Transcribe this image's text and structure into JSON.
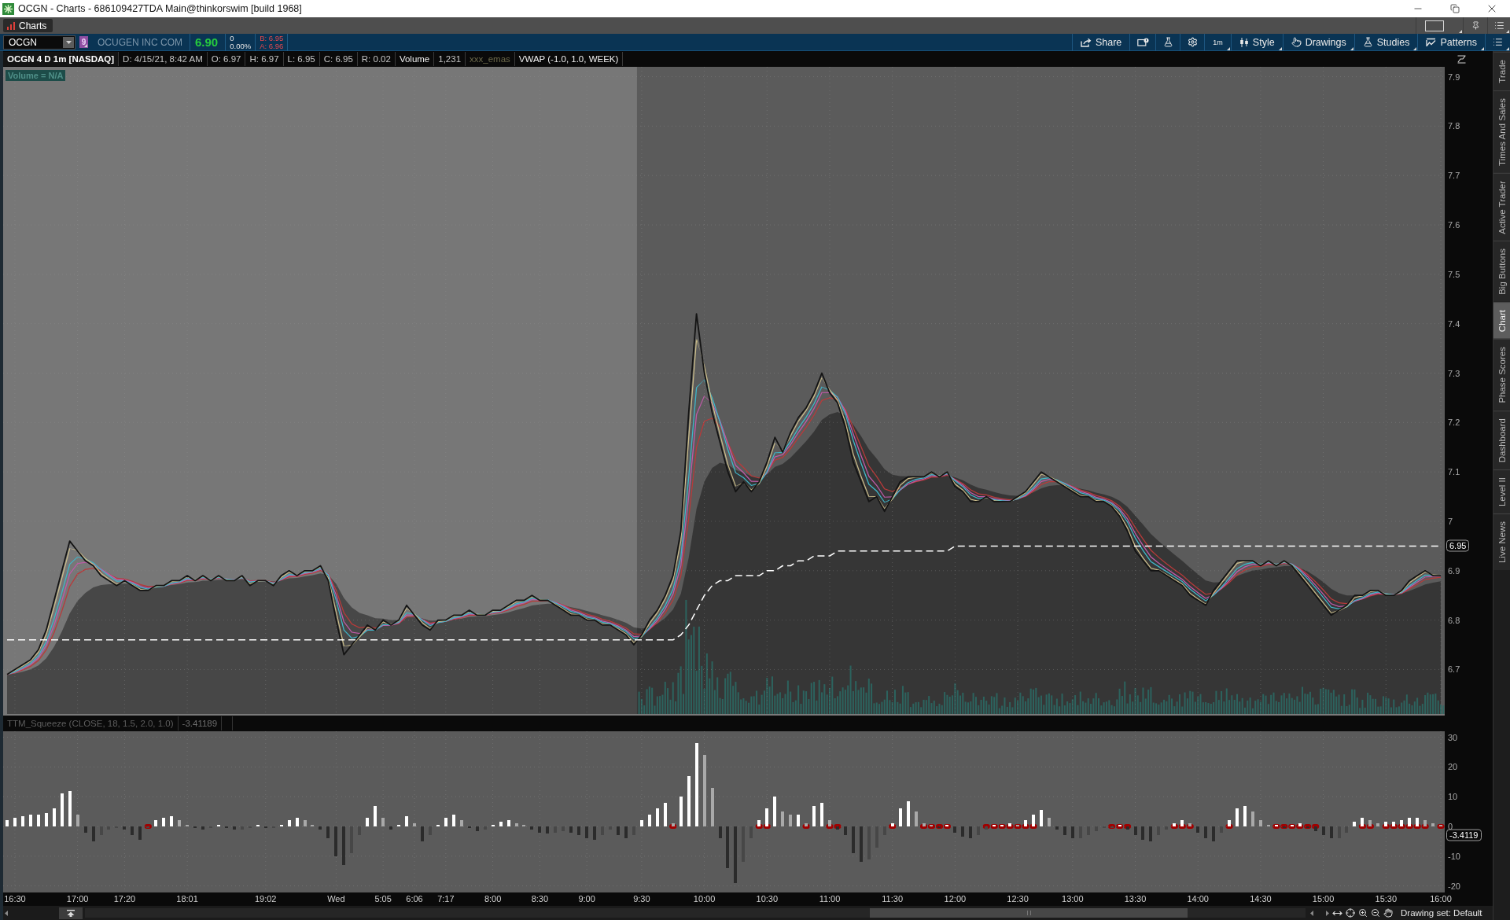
{
  "window": {
    "title": "OCGN - Charts - 686109427TDA Main@thinkorswim [build 1968]"
  },
  "tabs": [
    {
      "label": "Charts",
      "selected": true
    }
  ],
  "quote_bar": {
    "symbol": "OCGN",
    "link_group": "9",
    "description": "OCUGEN INC COM",
    "last": "6.90",
    "net_change": "0",
    "percent_change": "0.00%",
    "bid": "B: 6.95",
    "ask": "A: 6.96"
  },
  "toolbar": {
    "buttons": [
      {
        "label": "Share",
        "kind": "action"
      },
      {
        "label": "1m",
        "kind": "menu"
      },
      {
        "label": "Style",
        "kind": "menu"
      },
      {
        "label": "Drawings",
        "kind": "menu"
      },
      {
        "label": "Studies",
        "kind": "menu"
      },
      {
        "label": "Patterns",
        "kind": "menu"
      }
    ]
  },
  "legend": [
    {
      "text": "OCGN 4 D 1m [NASDAQ]",
      "kind": "symbol"
    },
    {
      "text": "D: 4/15/21, 8:42 AM",
      "kind": "field"
    },
    {
      "text": "O: 6.97",
      "kind": "field"
    },
    {
      "text": "H: 6.97",
      "kind": "field"
    },
    {
      "text": "L: 6.95",
      "kind": "field"
    },
    {
      "text": "C: 6.95",
      "kind": "field"
    },
    {
      "text": "R: 0.02",
      "kind": "field"
    },
    {
      "text": "Volume",
      "kind": "study"
    },
    {
      "text": "1,231",
      "kind": "field"
    },
    {
      "text": "xxx_emas",
      "kind": "muted"
    },
    {
      "text": "VWAP (-1.0, 1.0, WEEK)",
      "kind": "study"
    }
  ],
  "price_chart": {
    "volume_label": "Volume = N/A",
    "price_badge": "6.95",
    "chart_data": {
      "type": "line",
      "grid": true,
      "ylim": [
        6.61,
        7.92
      ],
      "yticks": [
        7.9,
        7.8,
        7.7,
        7.6,
        7.5,
        7.4,
        7.3,
        7.2,
        7.1,
        7,
        6.9,
        6.8,
        6.7
      ],
      "series": [
        {
          "color": "#141414",
          "values": [
            6.69,
            6.7,
            6.71,
            6.72,
            6.74,
            6.78,
            6.84,
            6.9,
            6.96,
            6.94,
            6.92,
            6.91,
            6.89,
            6.88,
            6.87,
            6.88,
            6.87,
            6.86,
            6.86,
            6.87,
            6.87,
            6.88,
            6.88,
            6.89,
            6.88,
            6.89,
            6.88,
            6.89,
            6.88,
            6.88,
            6.89,
            6.87,
            6.88,
            6.88,
            6.87,
            6.89,
            6.9,
            6.89,
            6.9,
            6.9,
            6.91,
            6.88,
            6.8,
            6.73,
            6.75,
            6.77,
            6.79,
            6.78,
            6.8,
            6.79,
            6.8,
            6.83,
            6.81,
            6.79,
            6.78,
            6.8,
            6.8,
            6.81,
            6.81,
            6.82,
            6.81,
            6.81,
            6.82,
            6.82,
            6.83,
            6.84,
            6.84,
            6.85,
            6.84,
            6.84,
            6.83,
            6.82,
            6.81,
            6.81,
            6.8,
            6.8,
            6.79,
            6.79,
            6.78,
            6.77,
            6.75,
            6.77,
            6.8,
            6.82,
            6.85,
            6.89,
            6.98,
            7.22,
            7.42,
            7.3,
            7.22,
            7.16,
            7.1,
            7.06,
            7.08,
            7.06,
            7.08,
            7.12,
            7.17,
            7.14,
            7.18,
            7.21,
            7.23,
            7.26,
            7.3,
            7.26,
            7.24,
            7.19,
            7.12,
            7.08,
            7.04,
            7.05,
            7.02,
            7.05,
            7.08,
            7.09,
            7.09,
            7.09,
            7.1,
            7.09,
            7.1,
            7.07,
            7.06,
            7.04,
            7.04,
            7.05,
            7.04,
            7.04,
            7.04,
            7.05,
            7.06,
            7.08,
            7.1,
            7.09,
            7.08,
            7.07,
            7.06,
            7.05,
            7.05,
            7.04,
            7.04,
            7.03,
            7.01,
            6.98,
            6.94,
            6.92,
            6.9,
            6.9,
            6.89,
            6.88,
            6.87,
            6.85,
            6.84,
            6.83,
            6.86,
            6.88,
            6.9,
            6.92,
            6.92,
            6.92,
            6.91,
            6.92,
            6.91,
            6.92,
            6.91,
            6.89,
            6.87,
            6.85,
            6.83,
            6.81,
            6.82,
            6.83,
            6.85,
            6.85,
            6.86,
            6.86,
            6.85,
            6.85,
            6.86,
            6.88,
            6.89,
            6.9,
            6.89,
            6.89
          ]
        },
        {
          "color": "#ffffff",
          "line_style": "dashed",
          "values": [
            6.76,
            6.76,
            6.76,
            6.76,
            6.76,
            6.76,
            6.76,
            6.76,
            6.76,
            6.76,
            6.76,
            6.76,
            6.76,
            6.76,
            6.76,
            6.76,
            6.76,
            6.76,
            6.76,
            6.76,
            6.76,
            6.76,
            6.76,
            6.76,
            6.76,
            6.76,
            6.76,
            6.76,
            6.76,
            6.76,
            6.76,
            6.76,
            6.76,
            6.76,
            6.76,
            6.76,
            6.76,
            6.76,
            6.76,
            6.76,
            6.76,
            6.76,
            6.76,
            6.76,
            6.76,
            6.76,
            6.76,
            6.76,
            6.76,
            6.76,
            6.76,
            6.76,
            6.76,
            6.76,
            6.76,
            6.76,
            6.76,
            6.76,
            6.76,
            6.76,
            6.76,
            6.76,
            6.76,
            6.76,
            6.76,
            6.76,
            6.76,
            6.76,
            6.76,
            6.76,
            6.76,
            6.76,
            6.76,
            6.76,
            6.76,
            6.76,
            6.76,
            6.76,
            6.76,
            6.76,
            6.76,
            6.76,
            6.76,
            6.76,
            6.76,
            6.76,
            6.77,
            6.79,
            6.82,
            6.85,
            6.87,
            6.88,
            6.88,
            6.89,
            6.89,
            6.89,
            6.89,
            6.9,
            6.9,
            6.91,
            6.91,
            6.92,
            6.92,
            6.93,
            6.93,
            6.93,
            6.94,
            6.94,
            6.94,
            6.94,
            6.94,
            6.94,
            6.94,
            6.94,
            6.94,
            6.94,
            6.94,
            6.94,
            6.94,
            6.94,
            6.94,
            6.95,
            6.95,
            6.95,
            6.95,
            6.95,
            6.95,
            6.95,
            6.95,
            6.95,
            6.95,
            6.95,
            6.95,
            6.95,
            6.95,
            6.95,
            6.95,
            6.95,
            6.95,
            6.95,
            6.95,
            6.95,
            6.95,
            6.95,
            6.95,
            6.95,
            6.95,
            6.95,
            6.95,
            6.95,
            6.95,
            6.95,
            6.95,
            6.95,
            6.95,
            6.95,
            6.95,
            6.95,
            6.95,
            6.95,
            6.95,
            6.95,
            6.95,
            6.95,
            6.95,
            6.95,
            6.95,
            6.95,
            6.95,
            6.95,
            6.95,
            6.95,
            6.95,
            6.95,
            6.95,
            6.95,
            6.95,
            6.95,
            6.95,
            6.95,
            6.95,
            6.95,
            6.95,
            6.95
          ]
        }
      ]
    }
  },
  "squeeze": {
    "legend": [
      "TTM_Squeeze (CLOSE, 18, 1.5, 2.0, 1.0)",
      "-3.41189"
    ],
    "value_badge": "-3.4119",
    "chart_data": {
      "type": "bar",
      "grid": true,
      "ylim": [
        -22.2,
        32
      ],
      "yticks": [
        30,
        20,
        10,
        0,
        -10,
        -20
      ],
      "categories": [
        null,
        "16:30",
        null,
        null,
        null,
        null,
        null,
        null,
        null,
        "17:00",
        null,
        null,
        null,
        null,
        null,
        "17:20",
        null,
        null,
        null,
        null,
        null,
        null,
        null,
        "18:01",
        null,
        null,
        null,
        null,
        null,
        null,
        null,
        null,
        null,
        "19:02",
        null,
        null,
        null,
        null,
        null,
        null,
        null,
        null,
        "Wed",
        null,
        null,
        null,
        null,
        null,
        "5:05",
        null,
        null,
        null,
        "6:06",
        null,
        null,
        null,
        "7:17",
        null,
        null,
        null,
        null,
        null,
        "8:00",
        null,
        null,
        null,
        null,
        null,
        "8:30",
        null,
        null,
        null,
        null,
        null,
        "9:00",
        null,
        null,
        null,
        null,
        null,
        null,
        "9:30",
        null,
        null,
        null,
        null,
        null,
        null,
        null,
        "10:00",
        null,
        null,
        null,
        null,
        null,
        null,
        null,
        "10:30",
        null,
        null,
        null,
        null,
        null,
        null,
        null,
        "11:00",
        null,
        null,
        null,
        null,
        null,
        null,
        null,
        "11:30",
        null,
        null,
        null,
        null,
        null,
        null,
        null,
        "12:00",
        null,
        null,
        null,
        null,
        null,
        null,
        null,
        "12:30",
        null,
        null,
        null,
        null,
        null,
        null,
        "13:00",
        null,
        null,
        null,
        null,
        null,
        null,
        null,
        "13:30",
        null,
        null,
        null,
        null,
        null,
        null,
        null,
        "14:00",
        null,
        null,
        null,
        null,
        null,
        null,
        null,
        "14:30",
        null,
        null,
        null,
        null,
        null,
        null,
        null,
        "15:00",
        null,
        null,
        null,
        null,
        null,
        null,
        null,
        "15:30",
        null,
        null,
        null,
        null,
        null,
        null,
        "16:00"
      ],
      "series": [
        {
          "values": [
            2,
            3,
            3.5,
            4,
            4,
            4.5,
            6,
            11,
            12,
            4,
            -2,
            -5,
            -3,
            -1,
            -0.5,
            -1,
            -3,
            -4.5,
            -0.5,
            2,
            3,
            3.5,
            2,
            0.5,
            -0.5,
            -1,
            -0.5,
            0.5,
            -0.5,
            -1,
            -1,
            -0.5,
            0.5,
            -0.5,
            -0.5,
            0.5,
            2,
            3,
            2,
            0.5,
            -1,
            -4,
            -10,
            -13,
            -9,
            -3,
            3,
            7,
            3,
            -1,
            0.5,
            3.5,
            1,
            -5,
            -3,
            0.5,
            3,
            4,
            2,
            -0.5,
            -1.5,
            -1,
            0.5,
            1.5,
            2,
            1,
            0.5,
            -1,
            -2,
            -2.5,
            -2,
            -1.5,
            -2,
            -3,
            -4,
            -4.5,
            -3,
            -1,
            -3,
            -4,
            -3,
            2,
            4,
            6,
            8,
            1,
            10,
            17,
            28,
            24,
            13,
            -4,
            -14,
            -19,
            -12,
            -4,
            2,
            6,
            10,
            5,
            4,
            4,
            1,
            7,
            8,
            2,
            -1,
            -3,
            -9,
            -12,
            -11,
            -7,
            -3,
            1,
            6,
            8.5,
            5,
            1,
            0.5,
            -0.5,
            0.5,
            -2,
            -3.5,
            -4,
            -3,
            -1,
            0.5,
            0.5,
            1,
            0.5,
            2,
            4,
            5.5,
            3,
            -1,
            -3,
            -4,
            -4,
            -3,
            -1.5,
            -0.5,
            -0.5,
            0.5,
            -1,
            -3,
            -4.5,
            -5,
            -3,
            -1,
            1,
            2,
            1,
            -2,
            -4,
            -5,
            -2,
            2,
            6,
            7,
            5,
            2,
            0.5,
            0.5,
            -0.5,
            0.5,
            1,
            -0.5,
            -1.5,
            -3,
            -4,
            -4,
            -2,
            1.5,
            3,
            2,
            1,
            1.5,
            1.5,
            2,
            3,
            3,
            2,
            1,
            0.5
          ]
        }
      ]
    },
    "squeeze_on": [
      false,
      false,
      false,
      false,
      false,
      false,
      false,
      false,
      false,
      false,
      false,
      false,
      false,
      false,
      false,
      false,
      false,
      false,
      true,
      false,
      false,
      false,
      false,
      false,
      false,
      false,
      false,
      false,
      false,
      false,
      false,
      false,
      false,
      false,
      false,
      false,
      false,
      false,
      false,
      false,
      false,
      false,
      false,
      false,
      false,
      false,
      false,
      false,
      false,
      false,
      false,
      false,
      false,
      false,
      false,
      false,
      false,
      false,
      false,
      false,
      false,
      false,
      false,
      false,
      false,
      false,
      false,
      false,
      false,
      false,
      false,
      false,
      false,
      false,
      false,
      false,
      false,
      false,
      false,
      false,
      false,
      false,
      false,
      false,
      false,
      true,
      false,
      false,
      false,
      false,
      false,
      false,
      false,
      false,
      false,
      false,
      true,
      true,
      false,
      false,
      false,
      false,
      true,
      false,
      false,
      true,
      true,
      false,
      false,
      false,
      false,
      false,
      false,
      true,
      false,
      false,
      false,
      true,
      true,
      true,
      true,
      false,
      false,
      false,
      false,
      true,
      true,
      true,
      true,
      true,
      true,
      true,
      false,
      false,
      false,
      false,
      false,
      false,
      false,
      false,
      false,
      true,
      true,
      true,
      false,
      false,
      false,
      false,
      false,
      true,
      true,
      true,
      false,
      false,
      false,
      false,
      true,
      false,
      false,
      false,
      false,
      false,
      true,
      true,
      true,
      true,
      true,
      true,
      false,
      false,
      false,
      false,
      false,
      true,
      true,
      false,
      true,
      true,
      true,
      true,
      true,
      true,
      false,
      true
    ]
  },
  "side_tabs": [
    {
      "label": "Trade",
      "selected": false
    },
    {
      "label": "Times And Sales",
      "selected": false
    },
    {
      "label": "Active Trader",
      "selected": false
    },
    {
      "label": "Big Buttons",
      "selected": false
    },
    {
      "label": "Chart",
      "selected": true
    },
    {
      "label": "Phase Scores",
      "selected": false
    },
    {
      "label": "Dashboard",
      "selected": false
    },
    {
      "label": "Level II",
      "selected": false
    },
    {
      "label": "Live News",
      "selected": false
    }
  ],
  "status": {
    "drawing_set": "Drawing set: Default"
  }
}
